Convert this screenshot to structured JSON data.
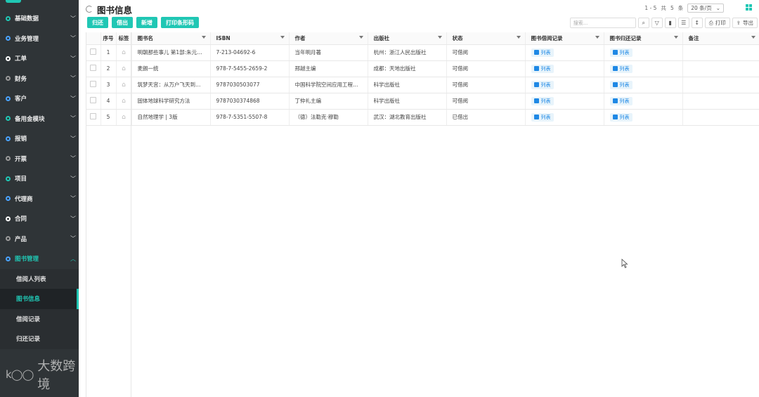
{
  "sidebar": {
    "items": [
      {
        "label": "基础数据",
        "dot": "teal"
      },
      {
        "label": "业务管理",
        "dot": "blue"
      },
      {
        "label": "工单",
        "dot": "white"
      },
      {
        "label": "财务",
        "dot": "gray"
      },
      {
        "label": "客户",
        "dot": "blue"
      },
      {
        "label": "备用金模块",
        "dot": "teal"
      },
      {
        "label": "报销",
        "dot": "blue"
      },
      {
        "label": "开票",
        "dot": "gray"
      },
      {
        "label": "项目",
        "dot": "teal"
      },
      {
        "label": "代理商",
        "dot": "blue"
      },
      {
        "label": "合同",
        "dot": "white"
      },
      {
        "label": "产品",
        "dot": "gray"
      },
      {
        "label": "图书管理",
        "dot": "blue",
        "open": true
      }
    ],
    "sub_items": [
      {
        "label": "借阅人列表"
      },
      {
        "label": "图书信息",
        "active": true
      },
      {
        "label": "借阅记录"
      },
      {
        "label": "归还记录"
      }
    ],
    "watermark": "大数跨境"
  },
  "header": {
    "title": "图书信息",
    "pager": {
      "range": "1 - 5",
      "total_prefix": "共",
      "total": "5",
      "total_suffix": "条",
      "page_size": "20 条/页"
    }
  },
  "toolbar": {
    "buttons": [
      "归还",
      "借出",
      "新增",
      "打印条形码"
    ],
    "search_placeholder": "搜索...",
    "print_label": "打印",
    "export_label": "导出"
  },
  "table": {
    "headers": {
      "index": "序号",
      "tag": "标签",
      "name": "图书名",
      "isbn": "ISBN",
      "author": "作者",
      "publisher": "出版社",
      "status": "状态",
      "borrow_records": "图书借阅记录",
      "return_records": "图书归还记录",
      "remark": "备注"
    },
    "link_label": "列表",
    "rows": [
      {
        "index": "1",
        "name": "明朝那些事儿 第1部:朱元璋...",
        "isbn": "7-213-04692-6",
        "author": "当年明月著",
        "publisher": "杭州：浙江人民出版社",
        "status": "可借阅"
      },
      {
        "index": "2",
        "name": "麦朗一统",
        "isbn": "978-7-5455-2659-2",
        "author": "邢越主编",
        "publisher": "成都：天地出版社",
        "status": "可借阅"
      },
      {
        "index": "3",
        "name": "筑梦天宫：从万户飞天到中...",
        "isbn": "9787030503077",
        "author": "中国科学院空间应用工程与...",
        "publisher": "科学出版社",
        "status": "可借阅"
      },
      {
        "index": "4",
        "name": "固体地球科学研究方法",
        "isbn": "9787030374868",
        "author": "丁仲礼主编",
        "publisher": "科学出版社",
        "status": "可借阅"
      },
      {
        "index": "5",
        "name": "自然地理学 | 3版",
        "isbn": "978-7-5351-5507-8",
        "author": "（德）法勒克·穆勒",
        "publisher": "武汉：湖北教育出版社",
        "status": "已借出"
      }
    ]
  }
}
